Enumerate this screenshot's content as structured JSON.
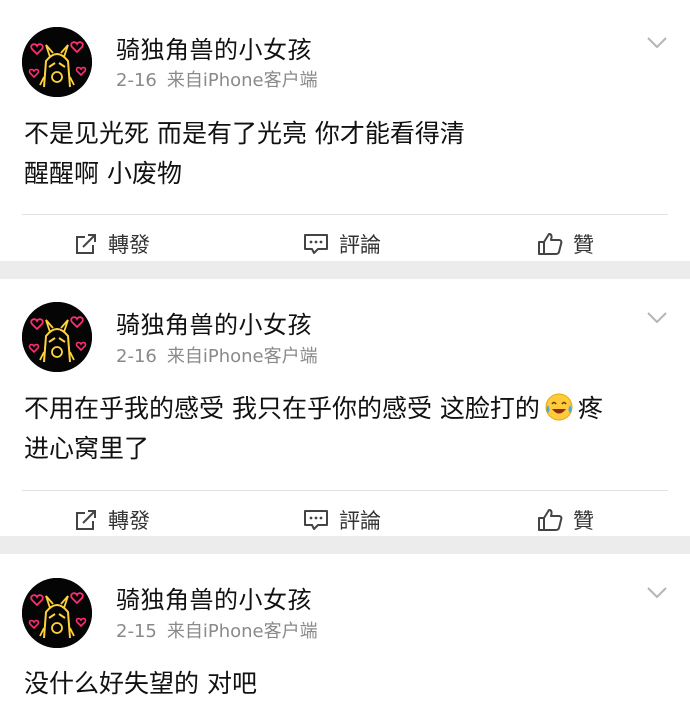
{
  "posts": [
    {
      "username": "骑独角兽的小女孩",
      "date": "2-16",
      "source": "来自iPhone客户端",
      "content_line1": "不是见光死 而是有了光亮 你才能看得清",
      "content_line2": "醒醒啊 小废物",
      "actions": {
        "repost": "轉發",
        "comment": "評論",
        "like": "贊"
      }
    },
    {
      "username": "骑独角兽的小女孩",
      "date": "2-16",
      "source": "来自iPhone客户端",
      "content_before_emoji": "不用在乎我的感受 我只在乎你的感受 这脸打的",
      "emoji": "joy-tears-emoji",
      "content_after_emoji": "疼",
      "content_line2": "进心窝里了",
      "actions": {
        "repost": "轉發",
        "comment": "評論",
        "like": "贊"
      }
    },
    {
      "username": "骑独角兽的小女孩",
      "date": "2-15",
      "source": "来自iPhone客户端",
      "content_line1": "没什么好失望的 对吧"
    }
  ],
  "colors": {
    "background": "#ececec",
    "card": "#ffffff",
    "meta": "#8a8a8a",
    "text": "#111111"
  },
  "icons": [
    "chevron-down-icon",
    "repost-icon",
    "comment-icon",
    "like-icon",
    "avatar-image"
  ]
}
